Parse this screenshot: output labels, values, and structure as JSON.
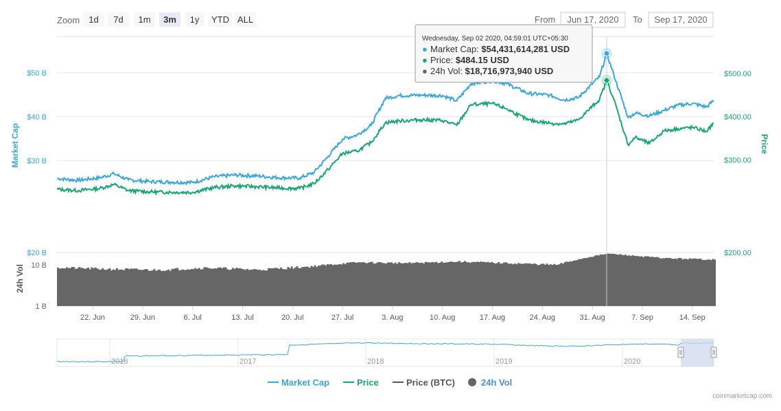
{
  "zoom": {
    "label": "Zoom",
    "buttons": [
      "1d",
      "7d",
      "1m",
      "3m",
      "1y",
      "YTD",
      "ALL"
    ],
    "selected": "3m"
  },
  "range": {
    "from_label": "From",
    "from_value": "Jun 17, 2020",
    "to_label": "To",
    "to_value": "Sep 17, 2020"
  },
  "colors": {
    "market_cap": "#37a7dd",
    "price": "#17a673",
    "price_btc": "#555555",
    "volume": "#666666",
    "navigator_band": "#cfd8ee"
  },
  "tooltip": {
    "title": "Wednesday, Sep 02 2020, 04:59:01 UTC+05:30",
    "rows": [
      {
        "label": "Market Cap:",
        "value": "$54,431,614,281 USD",
        "color": "#37a7dd"
      },
      {
        "label": "Price:",
        "value": "$484.15 USD",
        "color": "#17a673"
      },
      {
        "label": "24h Vol:",
        "value": "$18,716,973,940 USD",
        "color": "#666666"
      }
    ]
  },
  "legend": [
    {
      "name": "Market Cap",
      "color": "#37a7dd",
      "symbol": "line"
    },
    {
      "name": "Price",
      "color": "#17a673",
      "symbol": "line"
    },
    {
      "name": "Price (BTC)",
      "color": "#555555",
      "symbol": "line"
    },
    {
      "name": "24h Vol",
      "color": "#666666",
      "symbol": "dot"
    }
  ],
  "credit": "coinmarketcap.com",
  "chart_data": {
    "type": "line",
    "x_unit": "date",
    "x_ticks": [
      "22. Jun",
      "29. Jun",
      "6. Jul",
      "13. Jul",
      "20. Jul",
      "27. Jul",
      "3. Aug",
      "10. Aug",
      "17. Aug",
      "24. Aug",
      "31. Aug",
      "7. Sep",
      "14. Sep"
    ],
    "x_range": [
      "2020-06-17",
      "2020-09-17"
    ],
    "market_cap_axis": {
      "label": "Market Cap",
      "ticks": [
        "$50 B",
        "$40 B",
        "$30 B",
        "$20 B"
      ],
      "position": "left"
    },
    "price_axis": {
      "label": "Price",
      "ticks": [
        "$500.00",
        "$400.00",
        "$300.00",
        "$200.00"
      ],
      "position": "right"
    },
    "volume_axis": {
      "label": "24h Vol",
      "ticks": [
        "$20 B",
        "10 B",
        "1 B"
      ],
      "position": "left",
      "scale": "log"
    },
    "series": [
      {
        "name": "Market Cap",
        "unit": "USD B",
        "points": [
          [
            "2020-06-17",
            25.9
          ],
          [
            "2020-06-20",
            25.5
          ],
          [
            "2020-06-23",
            26.1
          ],
          [
            "2020-06-25",
            27.0
          ],
          [
            "2020-06-27",
            25.6
          ],
          [
            "2020-06-30",
            25.2
          ],
          [
            "2020-07-03",
            25.1
          ],
          [
            "2020-07-06",
            25.0
          ],
          [
            "2020-07-09",
            26.3
          ],
          [
            "2020-07-12",
            26.7
          ],
          [
            "2020-07-15",
            26.5
          ],
          [
            "2020-07-18",
            26.1
          ],
          [
            "2020-07-21",
            26.0
          ],
          [
            "2020-07-23",
            27.3
          ],
          [
            "2020-07-25",
            31.0
          ],
          [
            "2020-07-27",
            34.9
          ],
          [
            "2020-07-29",
            35.8
          ],
          [
            "2020-07-31",
            38.0
          ],
          [
            "2020-08-02",
            44.2
          ],
          [
            "2020-08-04",
            44.8
          ],
          [
            "2020-08-07",
            44.9
          ],
          [
            "2020-08-10",
            44.8
          ],
          [
            "2020-08-12",
            43.6
          ],
          [
            "2020-08-14",
            47.5
          ],
          [
            "2020-08-17",
            48.2
          ],
          [
            "2020-08-19",
            47.5
          ],
          [
            "2020-08-22",
            45.3
          ],
          [
            "2020-08-25",
            44.9
          ],
          [
            "2020-08-27",
            43.8
          ],
          [
            "2020-08-29",
            44.3
          ],
          [
            "2020-09-01",
            49.1
          ],
          [
            "2020-09-02",
            54.4
          ],
          [
            "2020-09-03",
            49.5
          ],
          [
            "2020-09-05",
            39.8
          ],
          [
            "2020-09-06",
            40.8
          ],
          [
            "2020-09-08",
            40.2
          ],
          [
            "2020-09-10",
            41.4
          ],
          [
            "2020-09-12",
            42.6
          ],
          [
            "2020-09-14",
            43.0
          ],
          [
            "2020-09-16",
            42.2
          ],
          [
            "2020-09-17",
            43.7
          ]
        ]
      },
      {
        "name": "Price",
        "unit": "USD",
        "points": [
          [
            "2020-06-17",
            232
          ],
          [
            "2020-06-20",
            229
          ],
          [
            "2020-06-23",
            234
          ],
          [
            "2020-06-25",
            243
          ],
          [
            "2020-06-27",
            229
          ],
          [
            "2020-06-30",
            226
          ],
          [
            "2020-07-03",
            225
          ],
          [
            "2020-07-06",
            225
          ],
          [
            "2020-07-09",
            236
          ],
          [
            "2020-07-12",
            240
          ],
          [
            "2020-07-15",
            238
          ],
          [
            "2020-07-18",
            235
          ],
          [
            "2020-07-21",
            234
          ],
          [
            "2020-07-23",
            245
          ],
          [
            "2020-07-25",
            278
          ],
          [
            "2020-07-27",
            315
          ],
          [
            "2020-07-29",
            320
          ],
          [
            "2020-07-31",
            340
          ],
          [
            "2020-08-02",
            386
          ],
          [
            "2020-08-04",
            390
          ],
          [
            "2020-08-07",
            393
          ],
          [
            "2020-08-10",
            391
          ],
          [
            "2020-08-12",
            380
          ],
          [
            "2020-08-14",
            428
          ],
          [
            "2020-08-17",
            430
          ],
          [
            "2020-08-19",
            418
          ],
          [
            "2020-08-22",
            392
          ],
          [
            "2020-08-25",
            385
          ],
          [
            "2020-08-27",
            383
          ],
          [
            "2020-08-29",
            392
          ],
          [
            "2020-09-01",
            440
          ],
          [
            "2020-09-02",
            484
          ],
          [
            "2020-09-03",
            440
          ],
          [
            "2020-09-05",
            335
          ],
          [
            "2020-09-06",
            352
          ],
          [
            "2020-09-08",
            338
          ],
          [
            "2020-09-10",
            367
          ],
          [
            "2020-09-12",
            372
          ],
          [
            "2020-09-14",
            375
          ],
          [
            "2020-09-16",
            366
          ],
          [
            "2020-09-17",
            385
          ]
        ]
      },
      {
        "name": "24h Vol",
        "unit": "USD B",
        "points": [
          [
            "2020-06-17",
            8.6
          ],
          [
            "2020-06-24",
            7.9
          ],
          [
            "2020-07-01",
            7.5
          ],
          [
            "2020-07-08",
            8.5
          ],
          [
            "2020-07-15",
            7.6
          ],
          [
            "2020-07-22",
            9.0
          ],
          [
            "2020-07-29",
            11.5
          ],
          [
            "2020-08-05",
            11.0
          ],
          [
            "2020-08-12",
            12.0
          ],
          [
            "2020-08-19",
            11.0
          ],
          [
            "2020-08-26",
            10.0
          ],
          [
            "2020-09-02",
            18.7
          ],
          [
            "2020-09-05",
            17.0
          ],
          [
            "2020-09-10",
            14.5
          ],
          [
            "2020-09-17",
            13.5
          ]
        ]
      }
    ],
    "navigator": {
      "ticks": [
        "2016",
        "2017",
        "2018",
        "2019",
        "2020"
      ],
      "selection": "3m"
    }
  }
}
